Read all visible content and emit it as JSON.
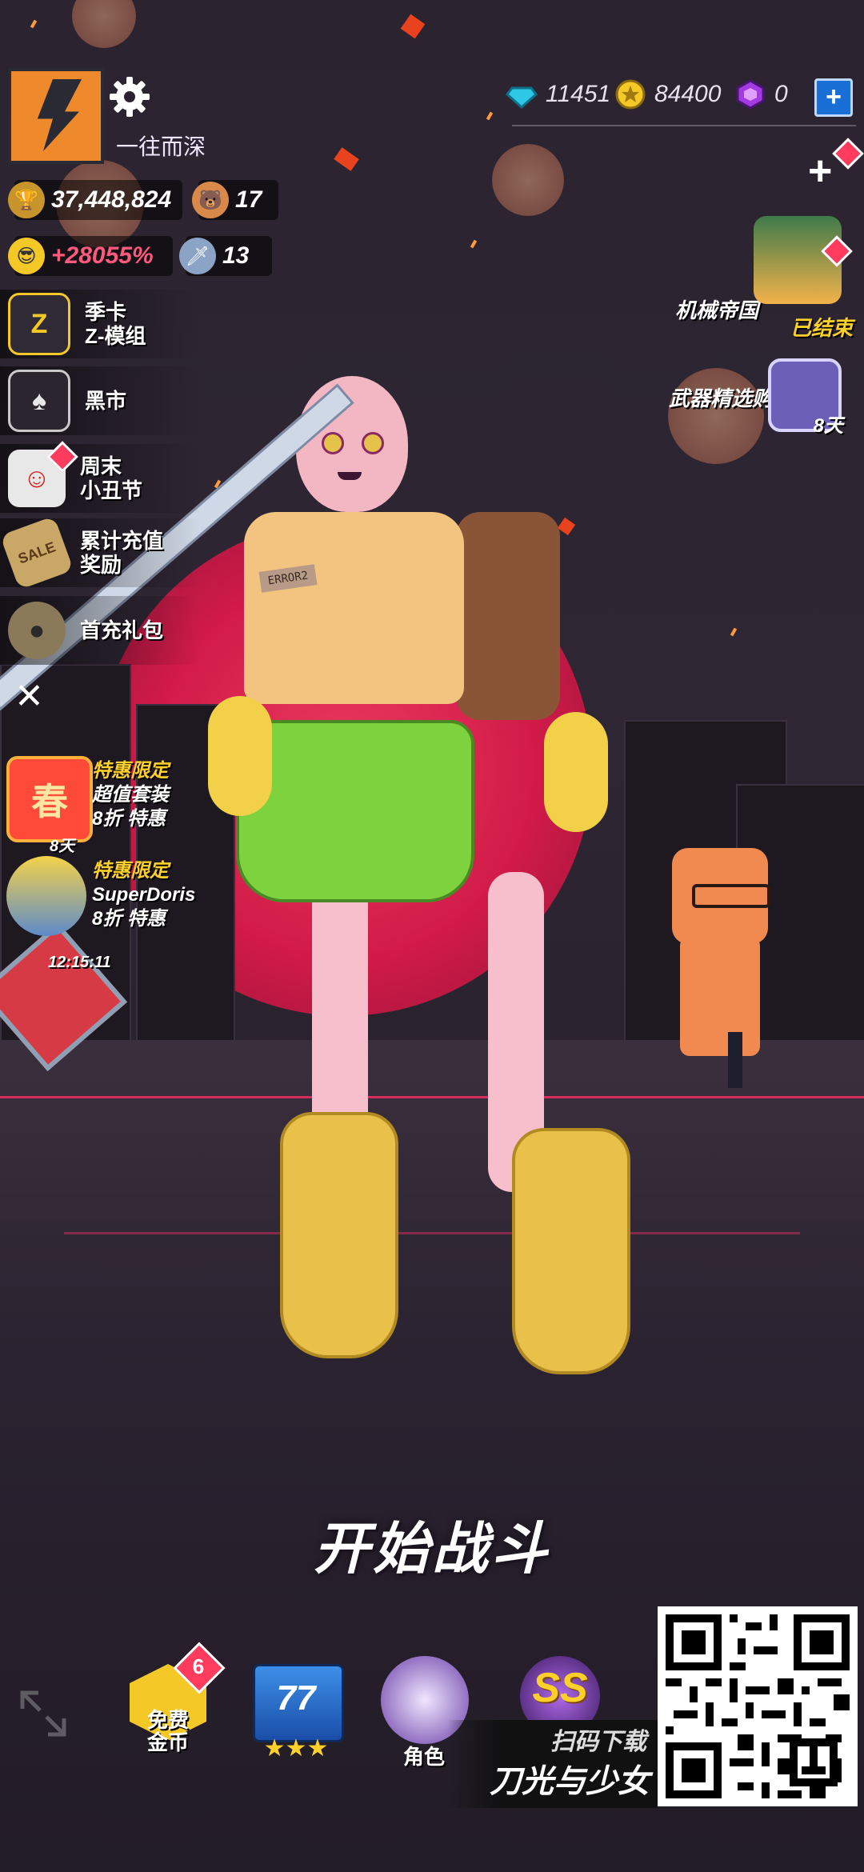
{
  "player": {
    "name": "一往而深",
    "trophies": "37,448,824",
    "bear_count": "17",
    "boost": "+28055%",
    "sword_count": "13"
  },
  "currencies": {
    "gems": "11451",
    "coins": "84400",
    "cubes": "0",
    "add_label": "+"
  },
  "left_menu": [
    {
      "label": "季卡\nZ-模组",
      "icon": "z-module-icon"
    },
    {
      "label": "黑市",
      "icon": "spade-icon"
    },
    {
      "label": "周末\n小丑节",
      "icon": "clown-icon"
    },
    {
      "label": "累计充值\n奖励",
      "icon": "sale-tag-icon"
    },
    {
      "label": "首充礼包",
      "icon": "gift-pouch-icon"
    }
  ],
  "offers": [
    {
      "tag": "特惠限定",
      "line2": "超值套装",
      "line3": "8折 特惠",
      "badge_text": "春",
      "timer": "8天"
    },
    {
      "tag": "特惠限定",
      "line2": "SuperDoris",
      "line3": "8折 特惠",
      "timer": "12:15:11"
    }
  ],
  "right_promos": [
    {
      "label": "机械帝国",
      "status": "已结束"
    },
    {
      "label": "武器精选购",
      "status": "8天"
    }
  ],
  "start_button": "开始战斗",
  "bottom_bar": {
    "free_coins": "免费\n金币",
    "free_coins_badge": "6",
    "level": "77",
    "role": "角色",
    "rank": "SS"
  },
  "download": {
    "scan": "扫码下载",
    "game_title": "刀光与少女"
  },
  "shirt_text": "ERROR2",
  "colors": {
    "accent_pink": "#ff2c68",
    "gold": "#ffd02a",
    "sun": "#e3194b"
  }
}
